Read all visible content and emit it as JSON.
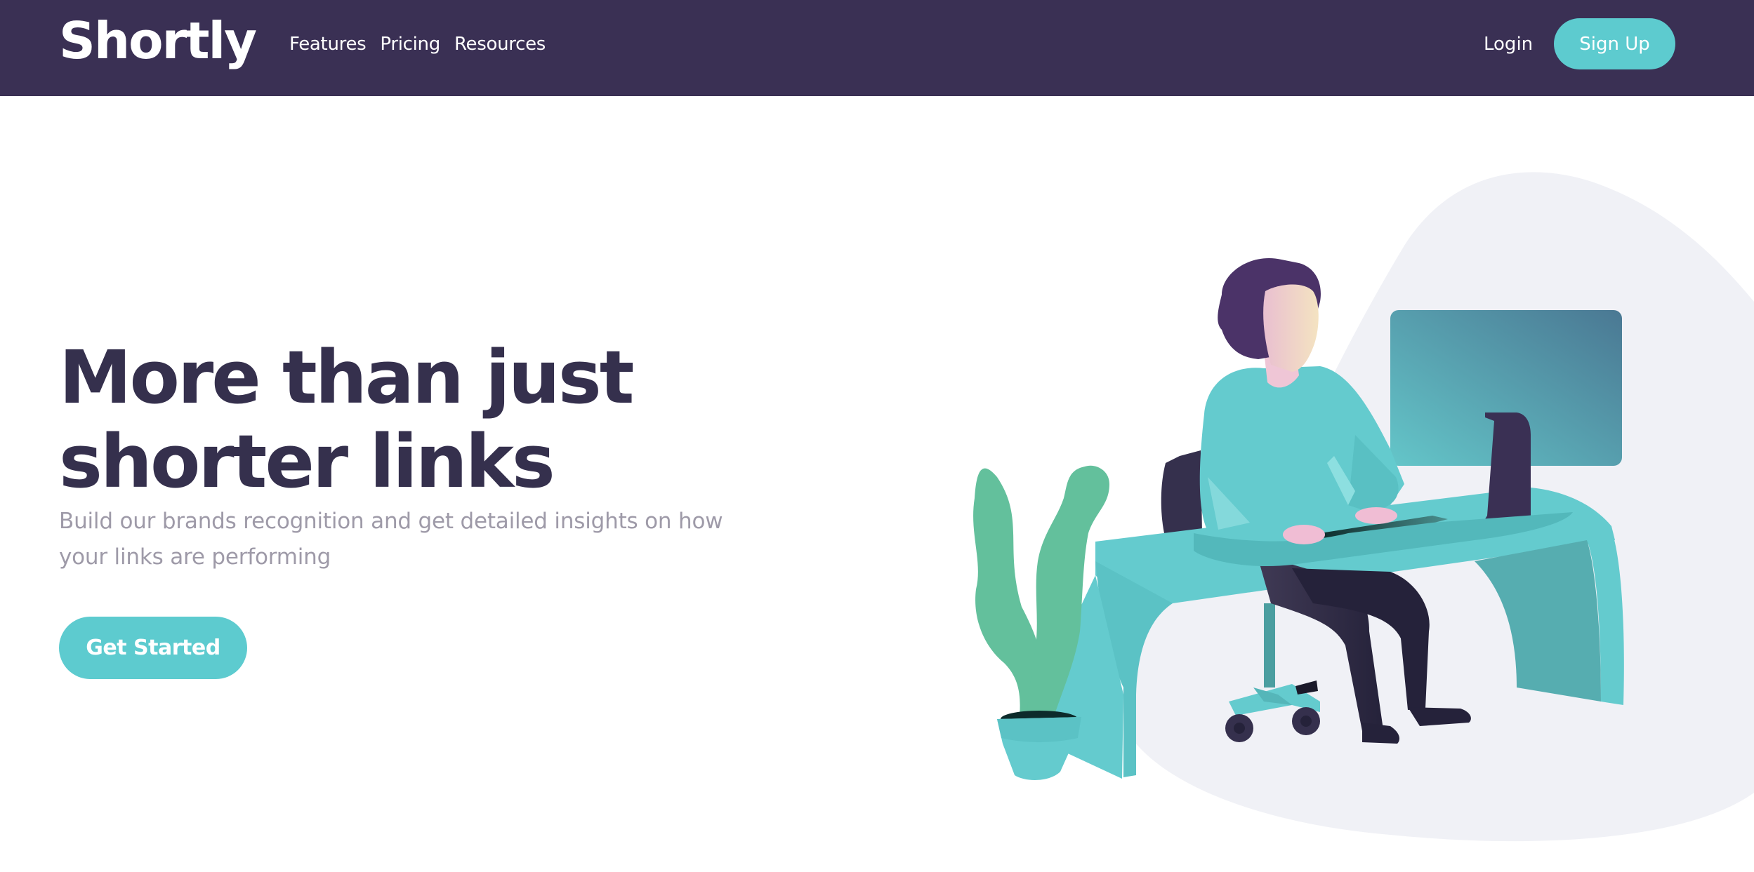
{
  "nav": {
    "logo": "Shortly",
    "links": [
      "Features",
      "Pricing",
      "Resources"
    ],
    "login": "Login",
    "signup": "Sign Up"
  },
  "hero": {
    "title_line1": "More than just",
    "title_line2": "shorter links",
    "subtitle": "Build our brands recognition and get detailed insights on how your links are performing",
    "cta": "Get Started"
  },
  "colors": {
    "navbar_bg": "#3a3054",
    "accent": "#5dcbcf",
    "title": "#35304d",
    "subtitle": "#9e9aa8",
    "blob": "#f0f1f6"
  },
  "illustration": {
    "icon": "person-working-illustration"
  }
}
